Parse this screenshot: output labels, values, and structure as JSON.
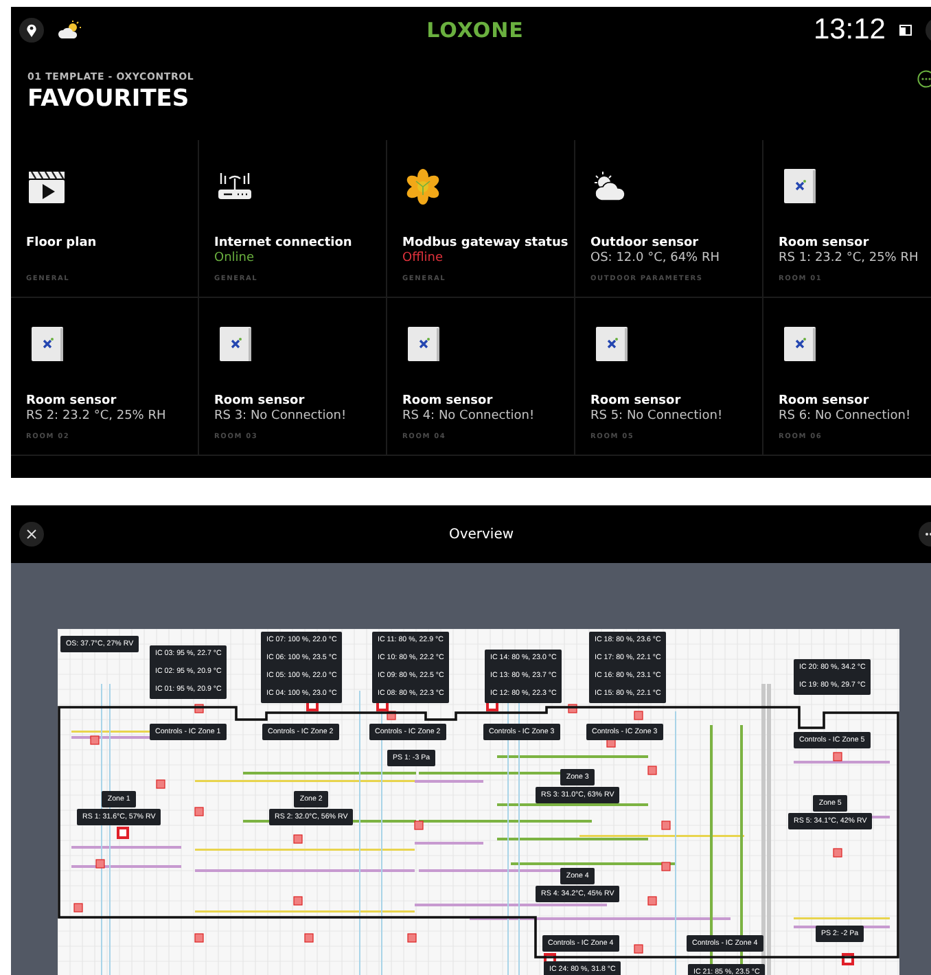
{
  "top_bar": {
    "logo": "LOXONE",
    "time": "13:12"
  },
  "header": {
    "subtitle": "01 TEMPLATE - OXYCONTROL",
    "title": "FAVOURITES"
  },
  "tiles": [
    {
      "kind": "clapperboard",
      "title": "Floor plan",
      "category": "GENERAL"
    },
    {
      "kind": "router",
      "title": "Internet connection",
      "status": "Online",
      "color": "#6ab03f",
      "category": "GENERAL"
    },
    {
      "kind": "gateway",
      "title": "Modbus gateway status",
      "status": "Offline",
      "color": "#e0323c",
      "category": "GENERAL"
    },
    {
      "kind": "weather",
      "title": "Outdoor sensor",
      "status": "OS: 12.0 °C, 64% RH",
      "color": "#c4c4c4",
      "category": "OUTDOOR PARAMETERS"
    },
    {
      "kind": "sensor",
      "title": "Room sensor",
      "status": "RS 1: 23.2 °C, 25% RH",
      "color": "#c4c4c4",
      "category": "ROOM 01"
    },
    {
      "kind": "sensor",
      "title": "Room sensor",
      "status": "RS 2: 23.2 °C, 25% RH",
      "color": "#c4c4c4",
      "category": "ROOM 02"
    },
    {
      "kind": "sensor",
      "title": "Room sensor",
      "status": "RS 3: No Connection!",
      "color": "#c4c4c4",
      "category": "ROOM 03"
    },
    {
      "kind": "sensor",
      "title": "Room sensor",
      "status": "RS 4: No Connection!",
      "color": "#c4c4c4",
      "category": "ROOM 04"
    },
    {
      "kind": "sensor",
      "title": "Room sensor",
      "status": "RS 5: No Connection!",
      "color": "#c4c4c4",
      "category": "ROOM 05"
    },
    {
      "kind": "sensor",
      "title": "Room sensor",
      "status": "RS 6: No Connection!",
      "color": "#c4c4c4",
      "category": "ROOM 06"
    }
  ],
  "overview": {
    "title": "Overview",
    "map_labels": [
      {
        "kind": "tag",
        "lines": [
          "OS: 37.7°C, 27% RV"
        ]
      },
      {
        "kind": "stack",
        "lines": [
          "IC 03: 95 %, 22.7 °C",
          "IC 02: 95 %, 20.9 °C",
          "IC 01: 95 %, 20.9 °C"
        ]
      },
      {
        "kind": "stack",
        "lines": [
          "IC 07: 100 %, 22.0 °C",
          "IC 06: 100 %, 23.5 °C",
          "IC 05: 100 %, 22.0 °C",
          "IC 04: 100 %, 23.0 °C"
        ]
      },
      {
        "kind": "stack",
        "lines": [
          "IC 11: 80 %, 22.9 °C",
          "IC 10: 80 %, 22.2 °C",
          "IC 09: 80 %, 22.5 °C",
          "IC 08: 80 %, 22.3 °C"
        ]
      },
      {
        "kind": "stack",
        "lines": [
          "IC 14: 80 %, 23.0 °C",
          "IC 13: 80 %, 23.7 °C",
          "IC 12: 80 %, 22.3 °C"
        ]
      },
      {
        "kind": "stack",
        "lines": [
          "IC 18: 80 %, 23.6 °C",
          "IC 17: 80 %, 22.1 °C",
          "IC 16: 80 %, 23.1 °C",
          "IC 15: 80 %, 22.1 °C"
        ]
      },
      {
        "kind": "stack",
        "lines": [
          "IC 20: 80 %, 34.2 °C",
          "IC 19: 80 %, 29.7 °C"
        ]
      },
      {
        "kind": "tag",
        "lines": [
          "Controls - IC Zone 1"
        ]
      },
      {
        "kind": "tag",
        "lines": [
          "Controls - IC Zone 2"
        ]
      },
      {
        "kind": "tag",
        "lines": [
          "Controls - IC Zone 2"
        ]
      },
      {
        "kind": "tag",
        "lines": [
          "Controls - IC Zone 3"
        ]
      },
      {
        "kind": "tag",
        "lines": [
          "Controls - IC Zone 3"
        ]
      },
      {
        "kind": "tag",
        "lines": [
          "Controls - IC Zone 5"
        ]
      },
      {
        "kind": "tag",
        "lines": [
          "PS 1: -3 Pa"
        ]
      },
      {
        "kind": "zone",
        "lines": [
          "Zone 1",
          "RS 1: 31.6°C, 57% RV"
        ]
      },
      {
        "kind": "zone",
        "lines": [
          "Zone 2",
          "RS 2: 32.0°C, 56% RV"
        ]
      },
      {
        "kind": "zone",
        "lines": [
          "Zone 3",
          "RS 3: 31.0°C, 63% RV"
        ]
      },
      {
        "kind": "zone",
        "lines": [
          "Zone 5",
          "RS 5: 34.1°C, 42% RV"
        ]
      },
      {
        "kind": "zone",
        "lines": [
          "Zone 4",
          "RS 4: 34.2°C, 45% RV"
        ]
      },
      {
        "kind": "tag",
        "lines": [
          "Controls - IC Zone 4"
        ]
      },
      {
        "kind": "tag",
        "lines": [
          "Controls - IC Zone 4"
        ]
      },
      {
        "kind": "tag",
        "lines": [
          "PS 2: -2 Pa"
        ]
      },
      {
        "kind": "tag",
        "lines": [
          "IC 24: 80 %, 31.8 °C"
        ]
      },
      {
        "kind": "tag",
        "lines": [
          "IC 21: 85 %, 23.5 °C"
        ]
      }
    ]
  }
}
